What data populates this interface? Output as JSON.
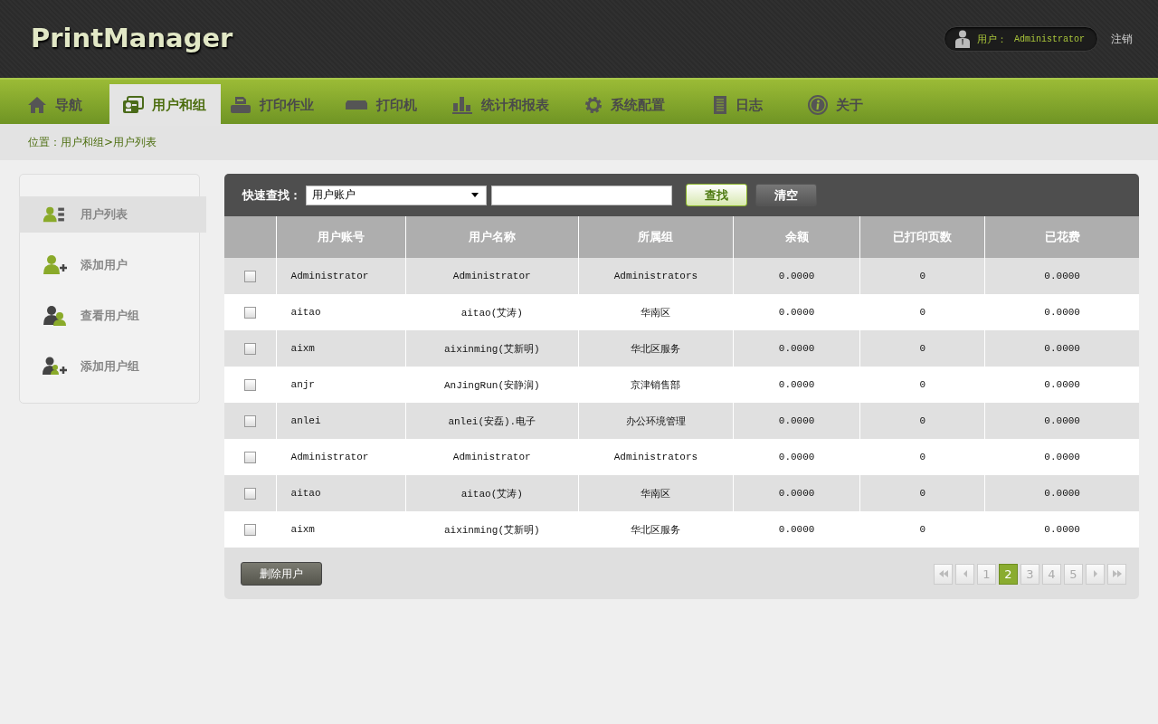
{
  "header": {
    "logo": "PrintManager",
    "user_label": "用户：",
    "user_name": "Administrator",
    "logout": "注销"
  },
  "nav": [
    {
      "label": "导航",
      "selected": false
    },
    {
      "label": "用户和组",
      "selected": true
    },
    {
      "label": "打印作业",
      "selected": false
    },
    {
      "label": "打印机",
      "selected": false
    },
    {
      "label": "统计和报表",
      "selected": false
    },
    {
      "label": "系统配置",
      "selected": false
    },
    {
      "label": "日志",
      "selected": false
    },
    {
      "label": "关于",
      "selected": false
    }
  ],
  "breadcrumb": "位置：用户和组>用户列表",
  "sidebar": {
    "items": [
      {
        "label": "用户列表",
        "selected": true
      },
      {
        "label": "添加用户",
        "selected": false
      },
      {
        "label": "查看用户组",
        "selected": false
      },
      {
        "label": "添加用户组",
        "selected": false
      }
    ]
  },
  "search": {
    "label": "快速查找：",
    "field": "用户账户",
    "search_button": "查找",
    "clear_button": "清空"
  },
  "table": {
    "columns": [
      "用户账号",
      "用户名称",
      "所属组",
      "余额",
      "已打印页数",
      "已花费"
    ],
    "rows": [
      {
        "checked": false,
        "cells": [
          "Administrator",
          "Administrator",
          "Administrators",
          "0.0000",
          "0",
          "0.0000"
        ]
      },
      {
        "checked": false,
        "cells": [
          "aitao",
          "aitao(艾涛)",
          "华南区",
          "0.0000",
          "0",
          "0.0000"
        ]
      },
      {
        "checked": false,
        "cells": [
          "aixm",
          "aixinming(艾新明)",
          "华北区服务",
          "0.0000",
          "0",
          "0.0000"
        ]
      },
      {
        "checked": false,
        "cells": [
          "anjr",
          "AnJingRun(安静润)",
          "京津销售部",
          "0.0000",
          "0",
          "0.0000"
        ]
      },
      {
        "checked": false,
        "cells": [
          "anlei",
          "anlei(安磊).电子",
          "办公环境管理",
          "0.0000",
          "0",
          "0.0000"
        ]
      },
      {
        "checked": false,
        "cells": [
          "Administrator",
          "Administrator",
          "Administrators",
          "0.0000",
          "0",
          "0.0000"
        ]
      },
      {
        "checked": false,
        "cells": [
          "aitao",
          "aitao(艾涛)",
          "华南区",
          "0.0000",
          "0",
          "0.0000"
        ]
      },
      {
        "checked": false,
        "cells": [
          "aixm",
          "aixinming(艾新明)",
          "华北区服务",
          "0.0000",
          "0",
          "0.0000"
        ]
      }
    ]
  },
  "delete_button": "删除用户",
  "pagination": [
    {
      "label": "1",
      "selected": false
    },
    {
      "label": "2",
      "selected": true
    },
    {
      "label": "3",
      "selected": false
    },
    {
      "label": "4",
      "selected": false
    },
    {
      "label": "5",
      "selected": false
    }
  ]
}
